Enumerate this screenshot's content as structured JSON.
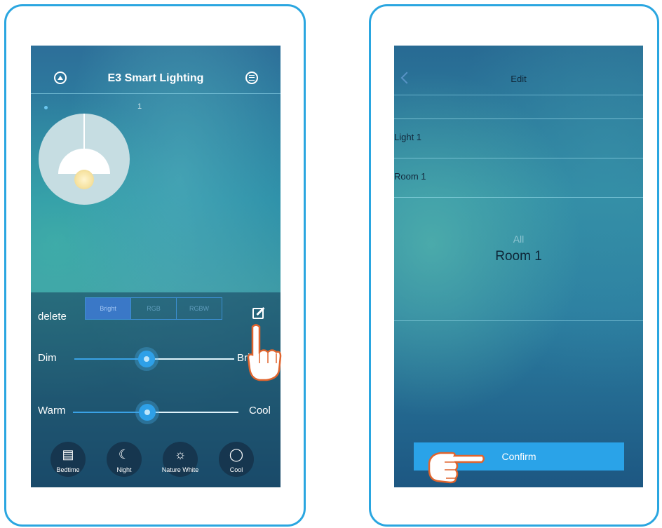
{
  "left_screen": {
    "title": "E3 Smart Lighting",
    "light_index": "1",
    "delete_label": "delete",
    "tabs": [
      "Bright",
      "RGB",
      "RGBW"
    ],
    "brightness": {
      "min_label": "Dim",
      "max_label": "Bright",
      "value": 0.45
    },
    "temperature": {
      "min_label": "Warm",
      "max_label": "Cool",
      "value": 0.45
    },
    "scenes": [
      {
        "label": "Bedtime",
        "icon": "bed-icon"
      },
      {
        "label": "Night",
        "icon": "moon-icon"
      },
      {
        "label": "Nature White",
        "icon": "sun-icon"
      },
      {
        "label": "Cool",
        "icon": "bulb-icon"
      }
    ]
  },
  "right_screen": {
    "title": "Edit",
    "rows": [
      "Light 1",
      "Room 1"
    ],
    "picker_options": [
      "All",
      "Room 1"
    ],
    "confirm_label": "Confirm"
  },
  "colors": {
    "frame_border": "#2aa6e0",
    "accent": "#2aa3e8",
    "hand_outline": "#e0642d"
  }
}
